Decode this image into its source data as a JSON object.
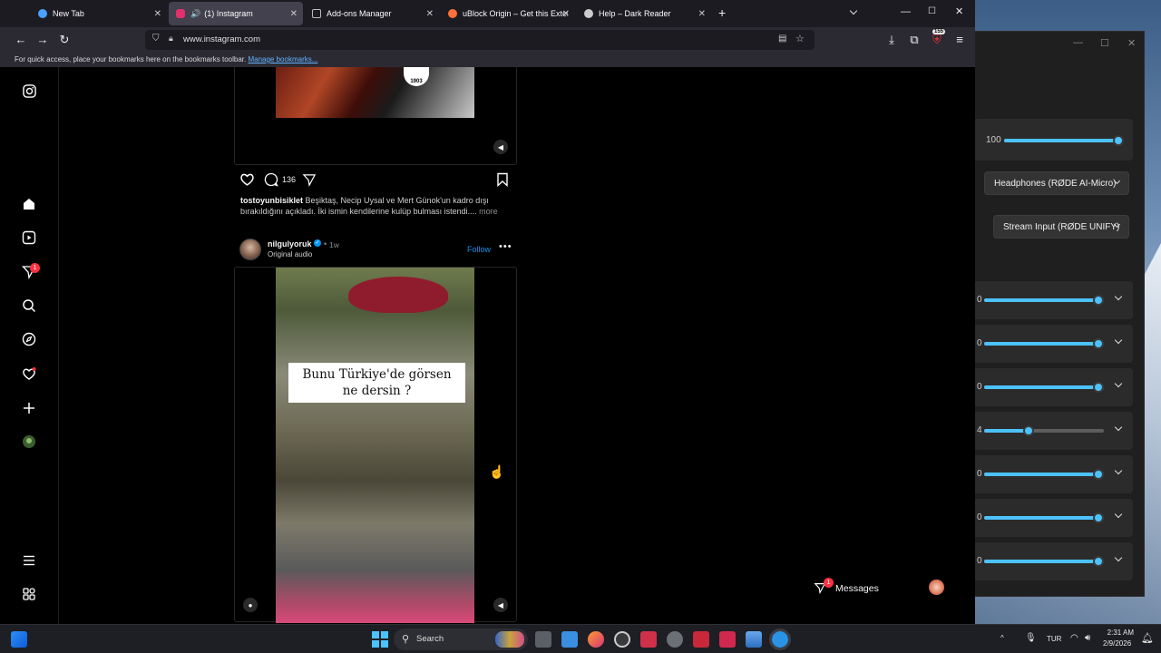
{
  "browser": {
    "tabs": [
      {
        "label": "New Tab",
        "color": "#4aa0ff"
      },
      {
        "label": "(1) Instagram",
        "color": "#e1306c"
      },
      {
        "label": "Add-ons Manager",
        "color": "#999999"
      },
      {
        "label": "uBlock Origin – Get this Extensio",
        "color": "#ff7139"
      },
      {
        "label": "Help – Dark Reader",
        "color": "#cccccc"
      }
    ],
    "url": "www.instagram.com",
    "bookmarks_hint": "For quick access, place your bookmarks here on the bookmarks toolbar.",
    "bookmarks_link": "Manage bookmarks...",
    "extensions_badge": "155"
  },
  "instagram": {
    "post1": {
      "comment_count": "136",
      "caption_user": "tostoyunbisiklet",
      "caption_text": " Beşiktaş, Necip Uysal ve Mert Günok'un kadro dışı bırakıldığını açıkladı. İki ismin kendilerine kulüp bulması istendi.... ",
      "more": "more"
    },
    "post2": {
      "username": "nilgulyoruk",
      "time": "1w",
      "audio": "Original audio",
      "follow": "Follow",
      "overlay_text": "Bunu  Türkiye'de görsen ne dersin ?"
    },
    "messages_label": "Messages",
    "messages_badge": "1",
    "notifications_badge": "1",
    "logo_text": "1903"
  },
  "mixer": {
    "master_value": "100",
    "output_device": "Headphones (RØDE AI-Micro)",
    "input_device": "Stream Input (RØDE UNIFY)",
    "channels": [
      {
        "label": "0",
        "level": 1.0
      },
      {
        "label": "0",
        "level": 1.0
      },
      {
        "label": "0",
        "level": 1.0
      },
      {
        "label": "4",
        "level": 0.36
      },
      {
        "label": "0",
        "level": 1.0
      },
      {
        "label": "0",
        "level": 1.0
      },
      {
        "label": "0",
        "level": 1.0
      }
    ]
  },
  "taskbar": {
    "search_placeholder": "Search",
    "language": "TUR",
    "time": "2:31 AM",
    "date": "2/9/2026"
  }
}
